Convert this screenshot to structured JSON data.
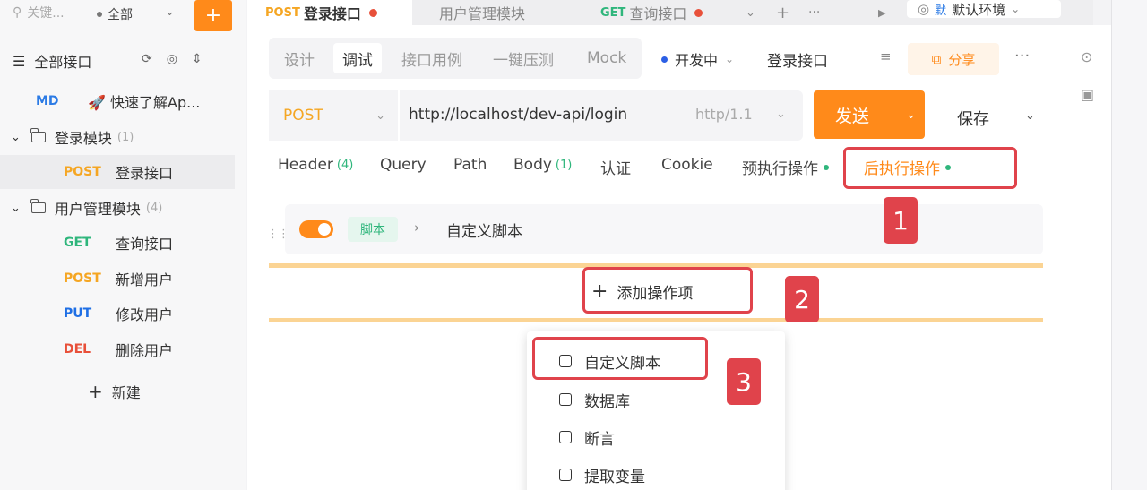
{
  "sidebar": {
    "search_placeholder": "关键...",
    "scope": "全部",
    "add_label": "+",
    "all_apis": "全部接口",
    "items": [
      {
        "method": "MD",
        "label": "🚀 快速了解Ap..."
      },
      {
        "folder": "登录模块",
        "count": "(1)"
      },
      {
        "method": "POST",
        "label": "登录接口"
      },
      {
        "folder": "用户管理模块",
        "count": "(4)"
      },
      {
        "method": "GET",
        "label": "查询接口"
      },
      {
        "method": "POST",
        "label": "新增用户"
      },
      {
        "method": "PUT",
        "label": "修改用户"
      },
      {
        "method": "DEL",
        "label": "删除用户"
      }
    ],
    "new_label": "新建"
  },
  "tabs": [
    {
      "method": "POST",
      "label": "登录接口"
    },
    {
      "label": "用户管理模块"
    },
    {
      "method": "GET",
      "label": "查询接口"
    }
  ],
  "environment": {
    "badge": "默",
    "label": "默认环境"
  },
  "subtabs": [
    "设计",
    "调试",
    "接口用例",
    "一键压测",
    "Mock"
  ],
  "dev_env": "开发中",
  "request_name": "登录接口",
  "share_label": "分享",
  "request": {
    "method": "POST",
    "url": "http://localhost/dev-api/login",
    "protocol": "http/1.1",
    "send_label": "发送",
    "save_label": "保存"
  },
  "param_tabs": [
    {
      "label": "Header",
      "count": "(4)"
    },
    {
      "label": "Query"
    },
    {
      "label": "Path"
    },
    {
      "label": "Body",
      "count": "(1)"
    },
    {
      "label": "认证"
    },
    {
      "label": "Cookie"
    },
    {
      "label": "预执行操作"
    },
    {
      "label": "后执行操作"
    }
  ],
  "script_row": {
    "tag": "脚本",
    "label": "自定义脚本"
  },
  "add_operation": "添加操作项",
  "menu": [
    "自定义脚本",
    "数据库",
    "断言",
    "提取变量"
  ],
  "annotations": [
    "1",
    "2",
    "3"
  ],
  "colors": {
    "accent": "#ff8a1a",
    "annotation": "#e0434b",
    "success": "#2fb67c"
  }
}
